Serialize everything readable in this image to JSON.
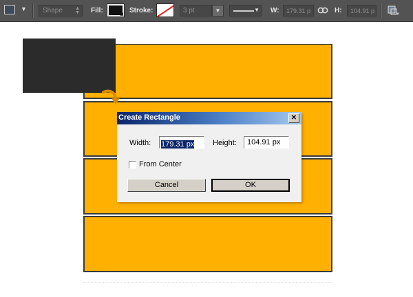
{
  "options_bar": {
    "mode": "Shape",
    "fill_label": "Fill:",
    "stroke_label": "Stroke:",
    "stroke_width": "3 pt",
    "w_label": "W:",
    "w_value": "179.31 p",
    "h_label": "H:",
    "h_value": "104.91 p"
  },
  "colors": {
    "stripe": "#ffb000",
    "dark_rect": "#2b2b2b",
    "toolbar": "#535353"
  },
  "dialog": {
    "title": "Create Rectangle",
    "close": "✕",
    "width_label": "Width:",
    "width_value": "179.31 px",
    "height_label": "Height:",
    "height_value": "104.91 px",
    "from_center_label": "From Center",
    "from_center_checked": false,
    "cancel": "Cancel",
    "ok": "OK"
  },
  "icons": {
    "tool": "rectangle-tool-icon",
    "link": "link-icon",
    "path_ops": "path-operations-icon",
    "cursor": "curved-arrow-cursor-icon"
  }
}
